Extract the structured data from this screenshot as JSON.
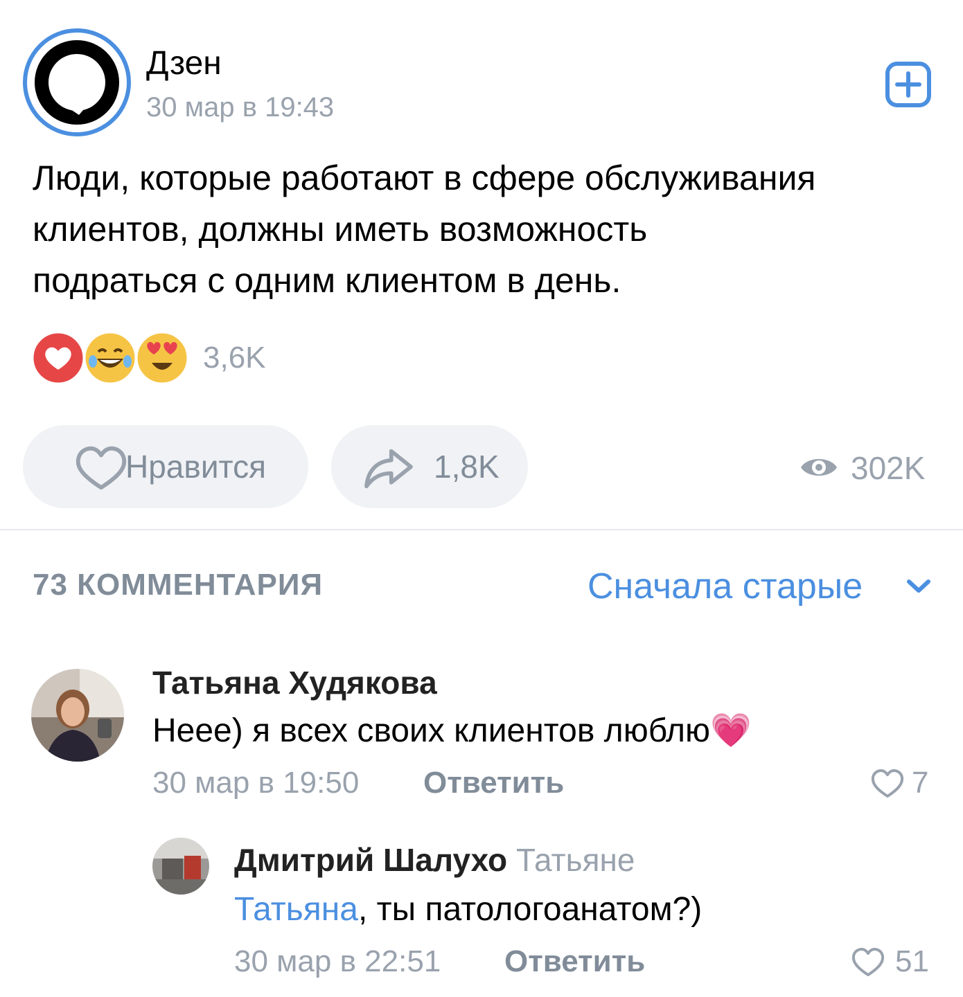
{
  "post": {
    "channel_name": "Дзен",
    "date": "30 мар в 19:43",
    "text": "Люди, которые работают в сфере обслуживания\nклиентов, должны иметь возможность\nподраться с одним клиентом в день.",
    "reactions": [
      "heart-reaction",
      "laughing-tears-emoji",
      "heart-eyes-emoji"
    ],
    "reactions_count": "3,6K",
    "like_label": "Нравится",
    "shares_count": "1,8K",
    "views_count": "302K"
  },
  "comments_section": {
    "title": "73 КОММЕНТАРИЯ",
    "sort_label": "Сначала старые"
  },
  "comments": [
    {
      "author": "Татьяна Худякова",
      "text": "Неее) я всех своих клиентов люблю💗",
      "date": "30 мар в 19:50",
      "reply_label": "Ответить",
      "likes": "7"
    },
    {
      "author": "Дмитрий Шалухо",
      "reply_to": "Татьяне",
      "mention": "Татьяна",
      "text": ", ты патологоанатом?)",
      "date": "30 мар в 22:51",
      "reply_label": "Ответить",
      "likes": "51"
    }
  ],
  "colors": {
    "accent": "#4b8fe0",
    "secondary_text": "#99a2ad",
    "pill_bg": "#f0f2f5"
  }
}
